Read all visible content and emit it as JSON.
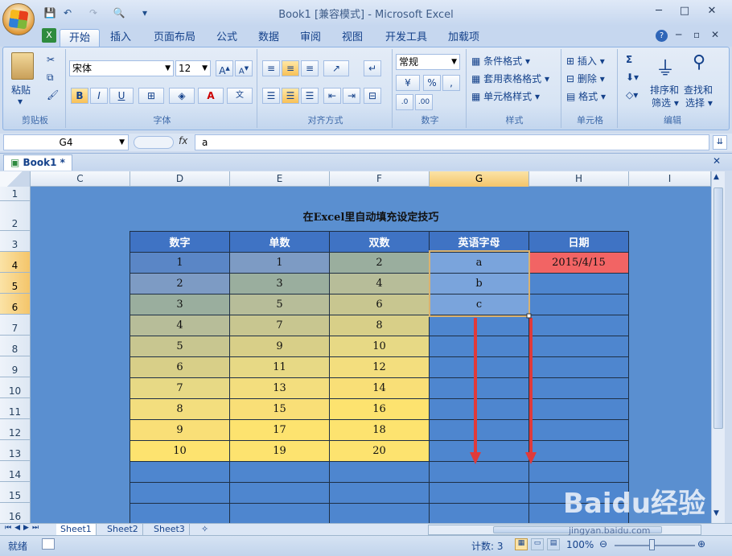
{
  "window": {
    "title": "Book1  [兼容模式] - Microsoft Excel"
  },
  "ribbon_tabs": [
    "开始",
    "插入",
    "页面布局",
    "公式",
    "数据",
    "审阅",
    "视图",
    "开发工具",
    "加载项"
  ],
  "ribbon": {
    "clipboard": {
      "label": "剪贴板",
      "paste": "粘贴"
    },
    "font": {
      "label": "字体",
      "name": "宋体",
      "size": "12",
      "bold": "B",
      "italic": "I",
      "underline": "U"
    },
    "alignment": {
      "label": "对齐方式"
    },
    "number": {
      "label": "数字",
      "format": "常规",
      "percent": "%",
      "comma": ","
    },
    "styles": {
      "label": "样式",
      "conditional": "条件格式",
      "table": "套用表格格式",
      "cell": "单元格样式"
    },
    "cells": {
      "label": "单元格",
      "insert": "插入",
      "delete": "删除",
      "format": "格式"
    },
    "editing": {
      "label": "编辑",
      "sort": "排序和",
      "sort2": "筛选",
      "find": "查找和",
      "find2": "选择",
      "sum": "Σ"
    }
  },
  "formula_bar": {
    "name_box": "G4",
    "fx": "fx",
    "value": "a"
  },
  "workbook_tab": "Book1 *",
  "columns": [
    "C",
    "D",
    "E",
    "F",
    "G",
    "H",
    "I"
  ],
  "rows": [
    "1",
    "2",
    "3",
    "4",
    "5",
    "6",
    "7",
    "8",
    "9",
    "10",
    "11",
    "12",
    "13",
    "14",
    "15",
    "16"
  ],
  "sheet_title": "在Excel里自动填充设定技巧",
  "table": {
    "headers": [
      "数字",
      "单数",
      "双数",
      "英语字母",
      "日期"
    ],
    "rows": [
      [
        "1",
        "1",
        "2",
        "a",
        "2015/4/15"
      ],
      [
        "2",
        "3",
        "4",
        "b",
        ""
      ],
      [
        "3",
        "5",
        "6",
        "c",
        ""
      ],
      [
        "4",
        "7",
        "8",
        "",
        ""
      ],
      [
        "5",
        "9",
        "10",
        "",
        ""
      ],
      [
        "6",
        "11",
        "12",
        "",
        ""
      ],
      [
        "7",
        "13",
        "14",
        "",
        ""
      ],
      [
        "8",
        "15",
        "16",
        "",
        ""
      ],
      [
        "9",
        "17",
        "18",
        "",
        ""
      ],
      [
        "10",
        "19",
        "20",
        "",
        ""
      ],
      [
        "",
        "",
        "",
        "",
        ""
      ],
      [
        "",
        "",
        "",
        "",
        ""
      ],
      [
        "",
        "",
        "",
        "",
        ""
      ]
    ],
    "colors": {
      "row_fills": [
        "#5a86c6",
        "#7d9bc4",
        "#9aae9e",
        "#b7bd99",
        "#c8c690",
        "#d8cf88",
        "#e7d985",
        "#f3de7e",
        "#f9df77",
        "#fde36f"
      ]
    }
  },
  "sheet_tabs": [
    "Sheet1",
    "Sheet2",
    "Sheet3"
  ],
  "status": {
    "ready": "就绪",
    "count": "计数: 3",
    "zoom": "100%"
  },
  "watermark": {
    "text": "Baidu经验",
    "sub": "jingyan.baidu.com"
  },
  "colors": {
    "sheet_bg": "#5a8fd0",
    "arrow": "#e03a3a",
    "date_cell": "#f26464"
  }
}
